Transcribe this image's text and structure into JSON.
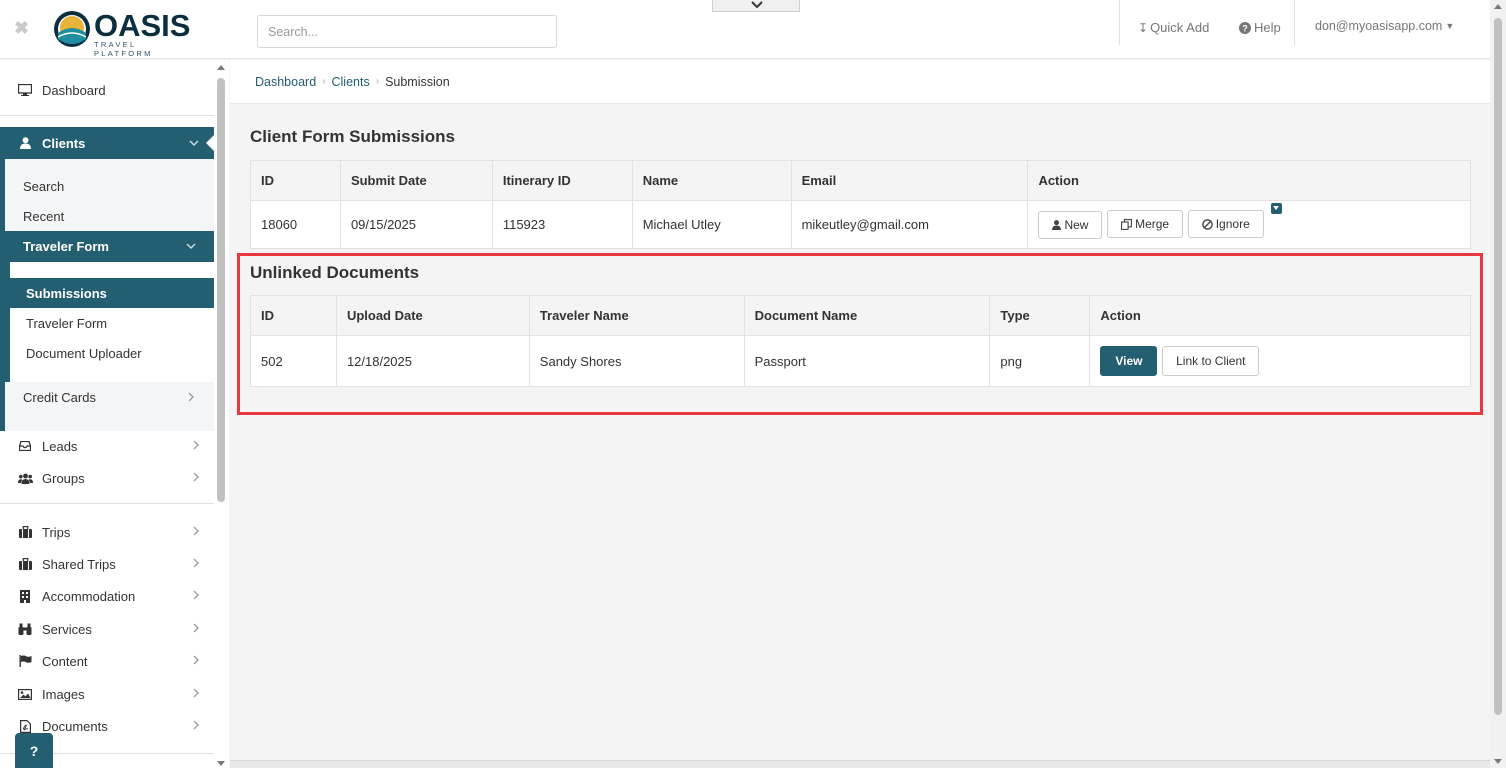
{
  "header": {
    "logo_word": "OASIS",
    "logo_sub": "TRAVEL PLATFORM",
    "search_placeholder": "Search...",
    "quick_add": "Quick Add",
    "help": "Help",
    "user": "don@myoasisapp.com"
  },
  "sidebar": {
    "dashboard": "Dashboard",
    "clients": "Clients",
    "search": "Search",
    "recent": "Recent",
    "traveler_form_group": "Traveler Form",
    "submissions": "Submissions",
    "traveler_form": "Traveler Form",
    "document_uploader": "Document Uploader",
    "credit_cards": "Credit Cards",
    "leads": "Leads",
    "groups": "Groups",
    "trips": "Trips",
    "shared_trips": "Shared Trips",
    "accommodation": "Accommodation",
    "services": "Services",
    "content": "Content",
    "images": "Images",
    "documents": "Documents",
    "help_fab": "?"
  },
  "breadcrumb": {
    "items": [
      "Dashboard",
      "Clients",
      "Submission"
    ]
  },
  "submissions": {
    "title": "Client Form Submissions",
    "columns": [
      "ID",
      "Submit Date",
      "Itinerary ID",
      "Name",
      "Email",
      "Action"
    ],
    "rows": [
      {
        "id": "18060",
        "submit_date": "09/15/2025",
        "itinerary_id": "115923",
        "name": "Michael Utley",
        "email": "mikeutley@gmail.com"
      }
    ],
    "actions": {
      "new": "New",
      "merge": "Merge",
      "ignore": "Ignore"
    }
  },
  "unlinked": {
    "title": "Unlinked Documents",
    "columns": [
      "ID",
      "Upload Date",
      "Traveler Name",
      "Document Name",
      "Type",
      "Action"
    ],
    "rows": [
      {
        "id": "502",
        "upload_date": "12/18/2025",
        "traveler_name": "Sandy Shores",
        "document_name": "Passport",
        "type": "png"
      }
    ],
    "actions": {
      "view": "View",
      "link": "Link to Client"
    }
  },
  "colors": {
    "primary": "#245e71",
    "highlight": "#e8383d"
  }
}
